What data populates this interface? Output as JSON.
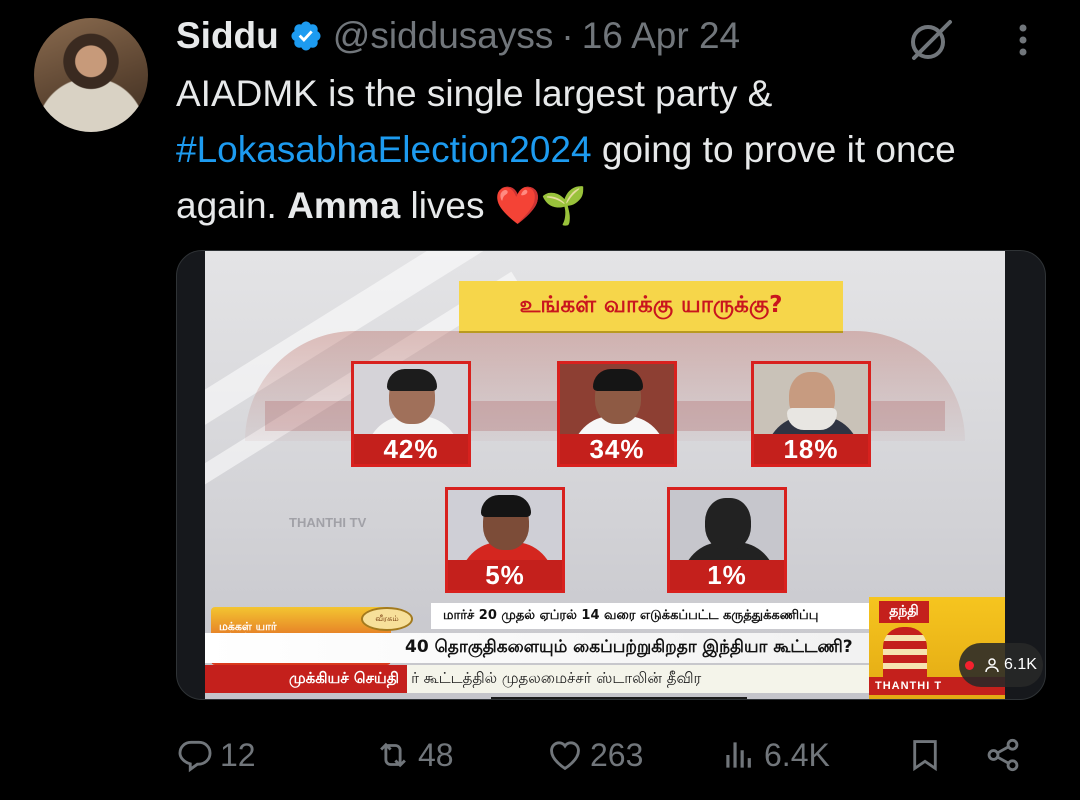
{
  "tweet": {
    "author_name": "Siddu",
    "handle": "@siddusayss",
    "separator": "·",
    "date": "16 Apr 24",
    "text_part1": "AIADMK is the single largest party & ",
    "hashtag": "#LokasabhaElection2024",
    "text_part2": " going to prove it once again. ",
    "text_bold": "Amma",
    "text_part3": " lives ",
    "emoji": "❤️🌱"
  },
  "media": {
    "question": "உங்கள் வாக்கு யாருக்கு?",
    "results": [
      {
        "percent": "42%"
      },
      {
        "percent": "34%"
      },
      {
        "percent": "18%"
      },
      {
        "percent": "5%"
      },
      {
        "percent": "1%"
      }
    ],
    "watermark": "THANTHI TV",
    "survey_note": "மார்ச் 20 முதல் ஏப்ரல் 14 வரை எடுக்கப்பட்ட கருத்துக்கணிப்பு",
    "headline": "40 தொகுதிகளையும் கைப்பற்றுகிறதா இந்தியா கூட்டணி?",
    "ticker_tag": "முக்கியச் செய்தி",
    "ticker_text": "ர் கூட்டத்தில் முதலமைச்சர் ஸ்டாலின் தீவிர",
    "program_logo": "மக்கள் யாா் பக்கம்",
    "program_badge": "வீரகம்",
    "channel_logo": "தந்தி",
    "channel_brand": "THANTHI T",
    "view_count": "6.1K"
  },
  "actions": {
    "replies": "12",
    "reposts": "48",
    "likes": "263",
    "views": "6.4K"
  },
  "colors": {
    "accent": "#1d9bf0",
    "muted": "#71767b",
    "tv_red": "#c4201c",
    "tv_yellow": "#f6d64a"
  }
}
